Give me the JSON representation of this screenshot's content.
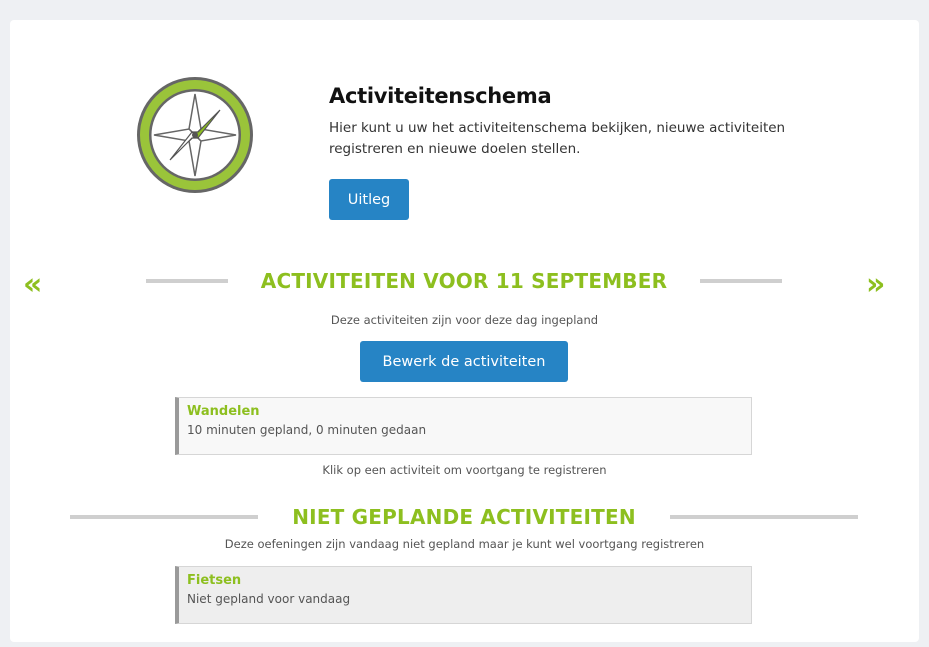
{
  "header": {
    "title": "Activiteitenschema",
    "description": "Hier kunt u uw het activiteitenschema bekijken, nieuwe activiteiten registreren en nieuwe doelen stellen.",
    "uitleg_label": "Uitleg"
  },
  "nav": {
    "prev": "«",
    "next": "»"
  },
  "planned": {
    "heading": "ACTIVITEITEN VOOR 11 SEPTEMBER",
    "subtitle": "Deze activiteiten zijn voor deze dag ingepland",
    "edit_label": "Bewerk de activiteiten",
    "items": [
      {
        "name": "Wandelen",
        "status": "10 minuten gepland, 0 minuten gedaan"
      }
    ],
    "hint": "Klik op een activiteit om voortgang te registreren"
  },
  "unplanned": {
    "heading": "NIET GEPLANDE ACTIVITEITEN",
    "subtitle": "Deze oefeningen zijn vandaag niet gepland maar je kunt wel voortgang registreren",
    "items": [
      {
        "name": "Fietsen",
        "status": "Niet gepland voor vandaag"
      }
    ]
  },
  "colors": {
    "accent_green": "#8dbf1f",
    "button_blue": "#2684c5"
  }
}
